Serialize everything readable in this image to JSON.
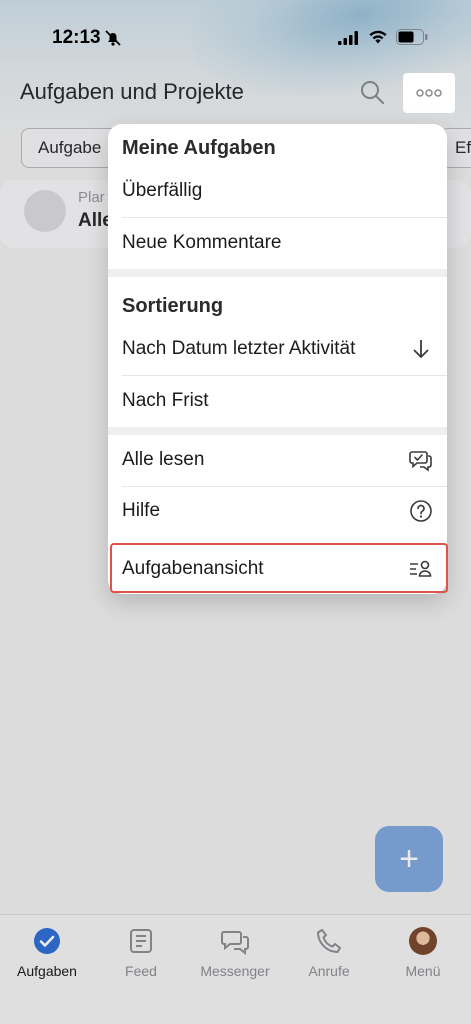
{
  "status_bar": {
    "time": "12:13"
  },
  "header": {
    "title": "Aufgaben und Projekte",
    "more_label": "ooo"
  },
  "filters": {
    "chip_left": "Aufgabe",
    "chip_right": "Ef"
  },
  "card": {
    "small": "Plar",
    "main": "Alle"
  },
  "fab": {
    "label": "+"
  },
  "menu": {
    "section1_header": "Meine Aufgaben",
    "overdue": "Überfällig",
    "new_comments": "Neue Kommentare",
    "section2_header": "Sortierung",
    "sort_by_activity": "Nach Datum letzter Aktivität",
    "sort_by_deadline": "Nach Frist",
    "read_all": "Alle lesen",
    "help": "Hilfe",
    "task_view": "Aufgabenansicht"
  },
  "tabs": [
    {
      "label": "Aufgaben",
      "icon": "check-circle-icon"
    },
    {
      "label": "Feed",
      "icon": "feed-icon"
    },
    {
      "label": "Messenger",
      "icon": "chat-icon"
    },
    {
      "label": "Anrufe",
      "icon": "phone-icon"
    },
    {
      "label": "Menü",
      "icon": "avatar"
    }
  ],
  "colors": {
    "accent": "#2f6fd6",
    "highlight": "#e0524c"
  }
}
